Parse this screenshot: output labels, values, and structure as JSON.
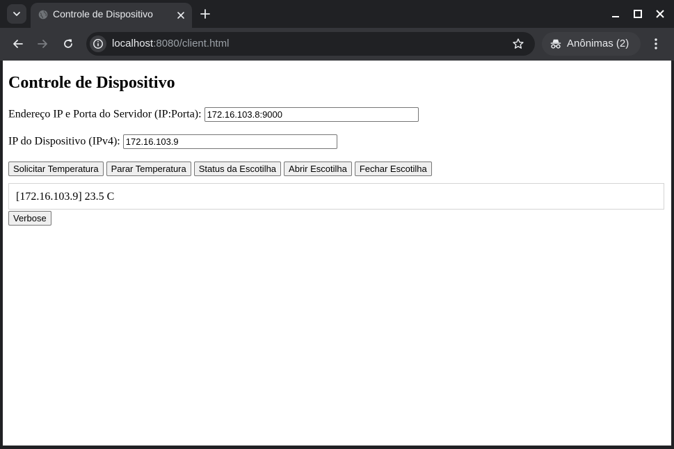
{
  "browser": {
    "tab_title": "Controle de Dispositivo",
    "url_host": "localhost",
    "url_path": ":8080/client.html",
    "incognito_label": "Anônimas (2)",
    "theme": {
      "frame": "#202124",
      "toolbar": "#35363a",
      "text": "#e8eaed"
    }
  },
  "page": {
    "title": "Controle de Dispositivo",
    "server_label": "Endereço IP e Porta do Servidor (IP:Porta):",
    "server_value": "172.16.103.8:9000",
    "device_label": "IP do Dispositivo (IPv4):",
    "device_value": "172.16.103.9",
    "buttons": {
      "request_temp": "Solicitar Temperatura",
      "stop_temp": "Parar Temperatura",
      "hatch_status": "Status da Escotilha",
      "open_hatch": "Abrir Escotilha",
      "close_hatch": "Fechar Escotilha",
      "verbose": "Verbose"
    },
    "log": [
      "[172.16.103.9] 23.5 C"
    ]
  }
}
